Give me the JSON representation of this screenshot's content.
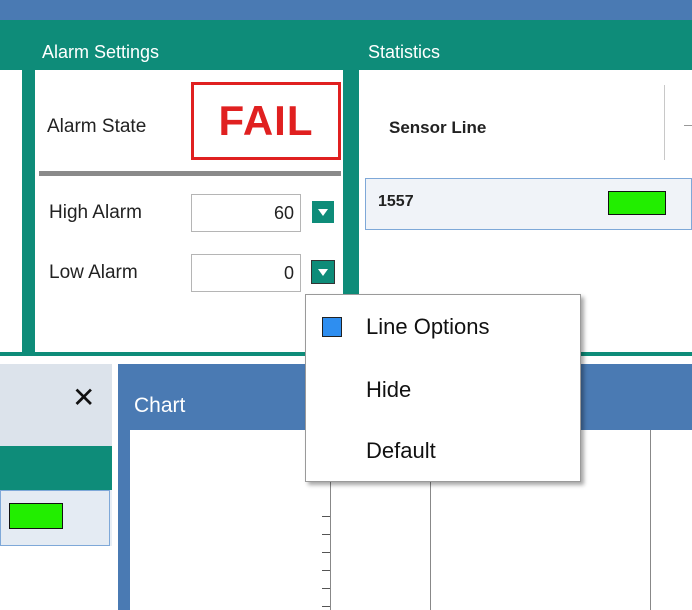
{
  "alarm_settings": {
    "title": "Alarm Settings",
    "alarm_state_label": "Alarm State",
    "alarm_state_value": "FAIL",
    "high_alarm_label": "High Alarm",
    "high_alarm_value": "60",
    "low_alarm_label": "Low Alarm",
    "low_alarm_value": "0"
  },
  "statistics": {
    "title": "Statistics",
    "column_header": "Sensor Line",
    "rows": [
      {
        "name": "1557",
        "color": "#22ee00"
      }
    ]
  },
  "chart_panel": {
    "title": "Chart",
    "close_icon": "close-icon"
  },
  "context_menu": {
    "items": [
      {
        "label": "Line Options",
        "checked": true
      },
      {
        "label": "Hide"
      },
      {
        "label": "Default"
      }
    ]
  },
  "colors": {
    "panel_header": "#0e8c79",
    "chart_header": "#4a7ab3",
    "fail_red": "#e02020",
    "sensor_green": "#22ee00",
    "checkbox_blue": "#2e8ef0"
  }
}
